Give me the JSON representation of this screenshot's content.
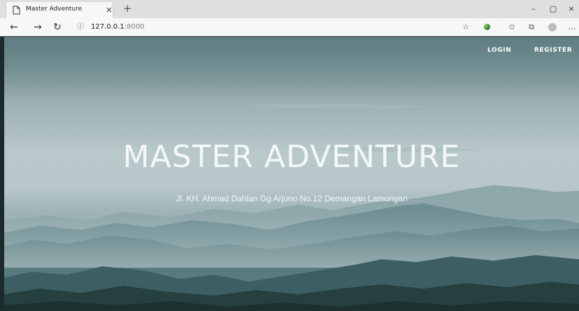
{
  "browser": {
    "tab_title": "Master Adventure",
    "tab_close": "×",
    "new_tab": "+",
    "url_host": "127.0.0.1",
    "url_port": ":8000",
    "icons": {
      "page": "page-icon",
      "back": "back-arrow-icon",
      "forward": "forward-arrow-icon",
      "refresh": "refresh-icon",
      "info": "info-icon",
      "favorite": "star-icon",
      "extension": "extension-icon",
      "favorites": "favorites-list-icon",
      "collections": "collections-icon",
      "profile": "profile-icon",
      "more": "more-icon"
    },
    "window": {
      "minimize": "–",
      "restore": "▢",
      "close": "×"
    }
  },
  "page": {
    "nav": {
      "login": "LOGIN",
      "register": "REGISTER"
    },
    "title": "MASTER ADVENTURE",
    "address": "Jl. KH. Ahmad Dahlan Gg Arjuno No.12 Demangan Lamongan"
  },
  "colors": {
    "sky": "#b9c8cb",
    "mountain_far": "#8aa3a8",
    "mountain_mid": "#4f7378",
    "mountain_near": "#2a4a4c",
    "text": "#ffffff"
  }
}
